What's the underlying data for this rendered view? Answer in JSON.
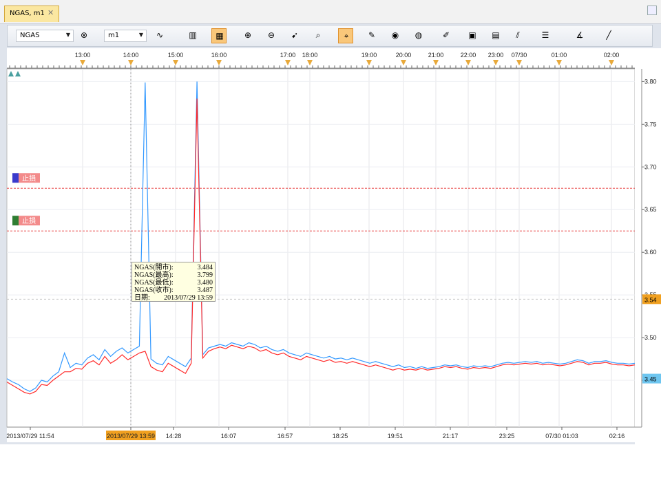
{
  "tab": {
    "title": "NGAS, m1",
    "close_glyph": "✕"
  },
  "toolbar": {
    "symbol": "NGAS",
    "timeframe": "m1",
    "buttons": [
      {
        "icon": "indicator-delete-icon",
        "glyph": "⊗",
        "active": false
      },
      {
        "icon": "chart-type-icon",
        "glyph": "∿",
        "active": false
      },
      {
        "icon": "bar-chart-icon",
        "glyph": "▥",
        "active": false
      },
      {
        "icon": "candle-chart-icon",
        "glyph": "▦",
        "active": true
      },
      {
        "icon": "zoom-in-icon",
        "glyph": "⊕",
        "active": false
      },
      {
        "icon": "zoom-out-icon",
        "glyph": "⊖",
        "active": false
      },
      {
        "icon": "cursor-icon",
        "glyph": "➹",
        "active": false
      },
      {
        "icon": "magnify-icon",
        "glyph": "⌕",
        "active": false
      },
      {
        "icon": "crosshair-icon",
        "glyph": "⌖",
        "active": true
      },
      {
        "icon": "edit-icon",
        "glyph": "✎",
        "active": false
      },
      {
        "icon": "eye-icon",
        "glyph": "◉",
        "active": false
      },
      {
        "icon": "globe-icon",
        "glyph": "◍",
        "active": false
      },
      {
        "icon": "ruler-icon",
        "glyph": "✐",
        "active": false
      },
      {
        "icon": "picture-icon",
        "glyph": "▣",
        "active": false
      },
      {
        "icon": "template-icon",
        "glyph": "▤",
        "active": false
      },
      {
        "icon": "fibonacci-icon",
        "glyph": "⫽",
        "active": false
      },
      {
        "icon": "horizontal-lines-icon",
        "glyph": "☰",
        "active": false
      },
      {
        "icon": "angle-icon",
        "glyph": "∡",
        "active": false
      },
      {
        "icon": "draw-line-icon",
        "glyph": "╱",
        "active": false
      }
    ]
  },
  "top_time_labels": [
    "13:00",
    "14:00",
    "15:00",
    "16:00",
    "17:00",
    "18:00",
    "19:00",
    "20:00",
    "21:00",
    "22:00",
    "23:00",
    "07/30",
    "01:00",
    "02:00"
  ],
  "bottom_time_labels": [
    "2013/07/29 11:54",
    "2013/07/29 13:59",
    "14:28",
    "16:07",
    "16:57",
    "18:25",
    "19:51",
    "21:17",
    "23:25",
    "07/30 01:03",
    "02:16"
  ],
  "price_labels": [
    "3.80",
    "3.75",
    "3.70",
    "3.65",
    "3.60",
    "3.55",
    "3.50",
    "3.45"
  ],
  "current_price_label": "3.54",
  "last_price_label": "3.45",
  "stop_orders": [
    {
      "label": "止損",
      "marker_color": "#3a3acc",
      "price": 3.675
    },
    {
      "label": "止損",
      "marker_color": "#2e7d32",
      "price": 3.625
    }
  ],
  "tooltip": {
    "rows": [
      {
        "k": "NGAS(開市):",
        "v": "3.484"
      },
      {
        "k": "NGAS(最高):",
        "v": "3.799"
      },
      {
        "k": "NGAS(最低):",
        "v": "3.480"
      },
      {
        "k": "NGAS(收市):",
        "v": "3.487"
      },
      {
        "k": "日期:",
        "v": "2013/07/29 13:59"
      }
    ]
  },
  "chart_data": {
    "type": "line",
    "ylim": [
      3.4,
      3.81
    ],
    "series": [
      {
        "color": "#3399ff",
        "values": [
          3.452,
          3.448,
          3.445,
          3.44,
          3.437,
          3.441,
          3.45,
          3.448,
          3.455,
          3.46,
          3.482,
          3.465,
          3.47,
          3.468,
          3.476,
          3.48,
          3.474,
          3.486,
          3.478,
          3.484,
          3.488,
          3.482,
          3.486,
          3.49,
          3.799,
          3.475,
          3.47,
          3.468,
          3.478,
          3.474,
          3.47,
          3.466,
          3.476,
          3.8,
          3.48,
          3.488,
          3.49,
          3.492,
          3.49,
          3.494,
          3.492,
          3.49,
          3.494,
          3.492,
          3.488,
          3.49,
          3.486,
          3.484,
          3.486,
          3.482,
          3.48,
          3.478,
          3.482,
          3.48,
          3.478,
          3.476,
          3.478,
          3.475,
          3.476,
          3.474,
          3.476,
          3.474,
          3.472,
          3.47,
          3.472,
          3.47,
          3.468,
          3.466,
          3.468,
          3.465,
          3.466,
          3.464,
          3.466,
          3.464,
          3.465,
          3.466,
          3.468,
          3.467,
          3.468,
          3.466,
          3.465,
          3.467,
          3.466,
          3.467,
          3.466,
          3.468,
          3.47,
          3.471,
          3.47,
          3.471,
          3.472,
          3.471,
          3.472,
          3.47,
          3.471,
          3.47,
          3.469,
          3.47,
          3.472,
          3.474,
          3.473,
          3.47,
          3.472,
          3.472,
          3.473,
          3.471,
          3.47,
          3.47,
          3.469,
          3.47
        ]
      },
      {
        "color": "#ff2a2a",
        "values": [
          3.448,
          3.444,
          3.44,
          3.436,
          3.434,
          3.437,
          3.445,
          3.444,
          3.45,
          3.455,
          3.46,
          3.46,
          3.464,
          3.463,
          3.47,
          3.473,
          3.468,
          3.478,
          3.47,
          3.474,
          3.48,
          3.474,
          3.478,
          3.482,
          3.484,
          3.466,
          3.462,
          3.46,
          3.47,
          3.466,
          3.462,
          3.458,
          3.47,
          3.78,
          3.476,
          3.484,
          3.487,
          3.489,
          3.487,
          3.491,
          3.489,
          3.487,
          3.49,
          3.488,
          3.484,
          3.486,
          3.482,
          3.48,
          3.482,
          3.478,
          3.476,
          3.474,
          3.478,
          3.476,
          3.474,
          3.472,
          3.474,
          3.471,
          3.472,
          3.47,
          3.472,
          3.47,
          3.468,
          3.466,
          3.468,
          3.466,
          3.464,
          3.462,
          3.464,
          3.462,
          3.463,
          3.462,
          3.464,
          3.462,
          3.463,
          3.464,
          3.466,
          3.465,
          3.466,
          3.464,
          3.463,
          3.465,
          3.464,
          3.465,
          3.464,
          3.466,
          3.468,
          3.469,
          3.468,
          3.469,
          3.47,
          3.469,
          3.47,
          3.468,
          3.469,
          3.468,
          3.467,
          3.468,
          3.47,
          3.472,
          3.471,
          3.468,
          3.47,
          3.47,
          3.471,
          3.469,
          3.468,
          3.468,
          3.467,
          3.468
        ]
      }
    ]
  }
}
